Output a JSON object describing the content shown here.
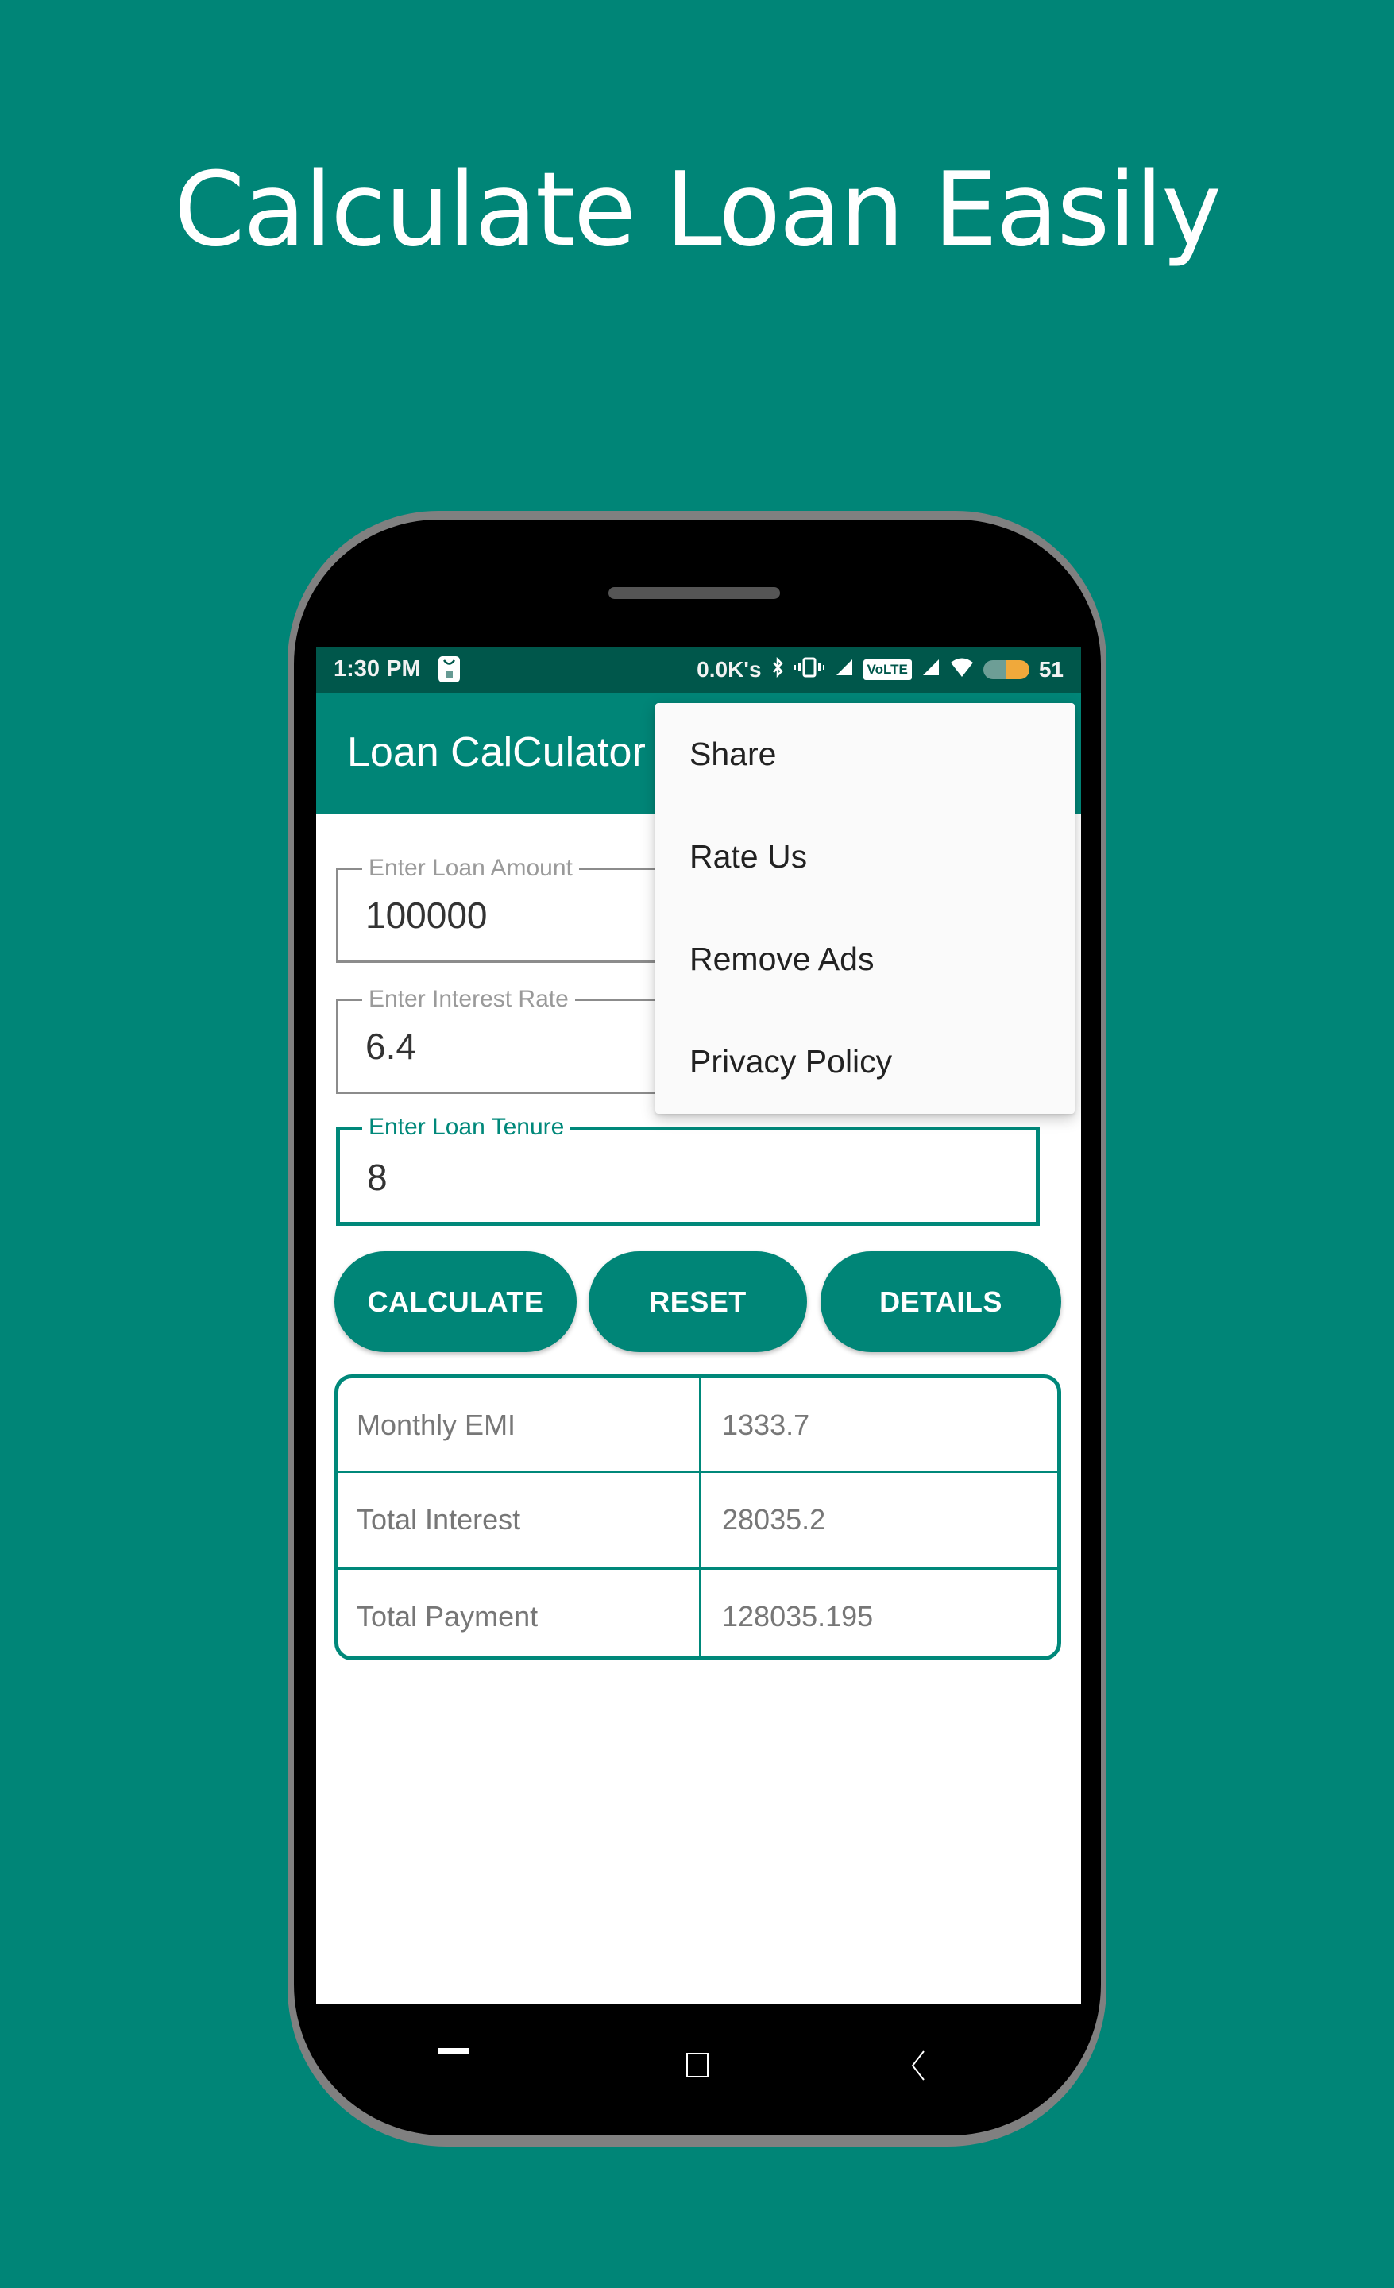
{
  "promo": {
    "headline": "Calculate Loan Easily"
  },
  "status_bar": {
    "time": "1:30 PM",
    "speed": "0.0K's",
    "volte": "VoLTE",
    "battery": "51",
    "icons": [
      "mi-store-icon",
      "bluetooth-icon",
      "vibrate-icon",
      "signal-icon",
      "volte-icon",
      "signal-icon",
      "wifi-icon",
      "battery-icon"
    ]
  },
  "app_bar": {
    "title": "Loan CalCulator"
  },
  "overflow_menu": {
    "items": [
      {
        "label": "Share"
      },
      {
        "label": "Rate Us"
      },
      {
        "label": "Remove Ads"
      },
      {
        "label": "Privacy Policy"
      }
    ]
  },
  "form": {
    "loan_amount": {
      "label": "Enter Loan Amount",
      "value": "100000"
    },
    "interest_rate": {
      "label": "Enter Interest Rate",
      "value": "6.4"
    },
    "loan_tenure": {
      "label": "Enter Loan Tenure",
      "value": "8"
    }
  },
  "buttons": {
    "calculate": "CALCULATE",
    "reset": "RESET",
    "details": "DETAILS"
  },
  "results": {
    "rows": [
      {
        "label": "Monthly EMI",
        "value": "1333.7"
      },
      {
        "label": "Total Interest",
        "value": "28035.2"
      },
      {
        "label": "Total Payment",
        "value": "128035.195"
      }
    ]
  },
  "nav_bar": {
    "icons": [
      "recents-icon",
      "home-icon",
      "back-icon"
    ]
  },
  "colors": {
    "background": "#008577",
    "status_bar": "#00574B",
    "accent": "#00887A"
  }
}
